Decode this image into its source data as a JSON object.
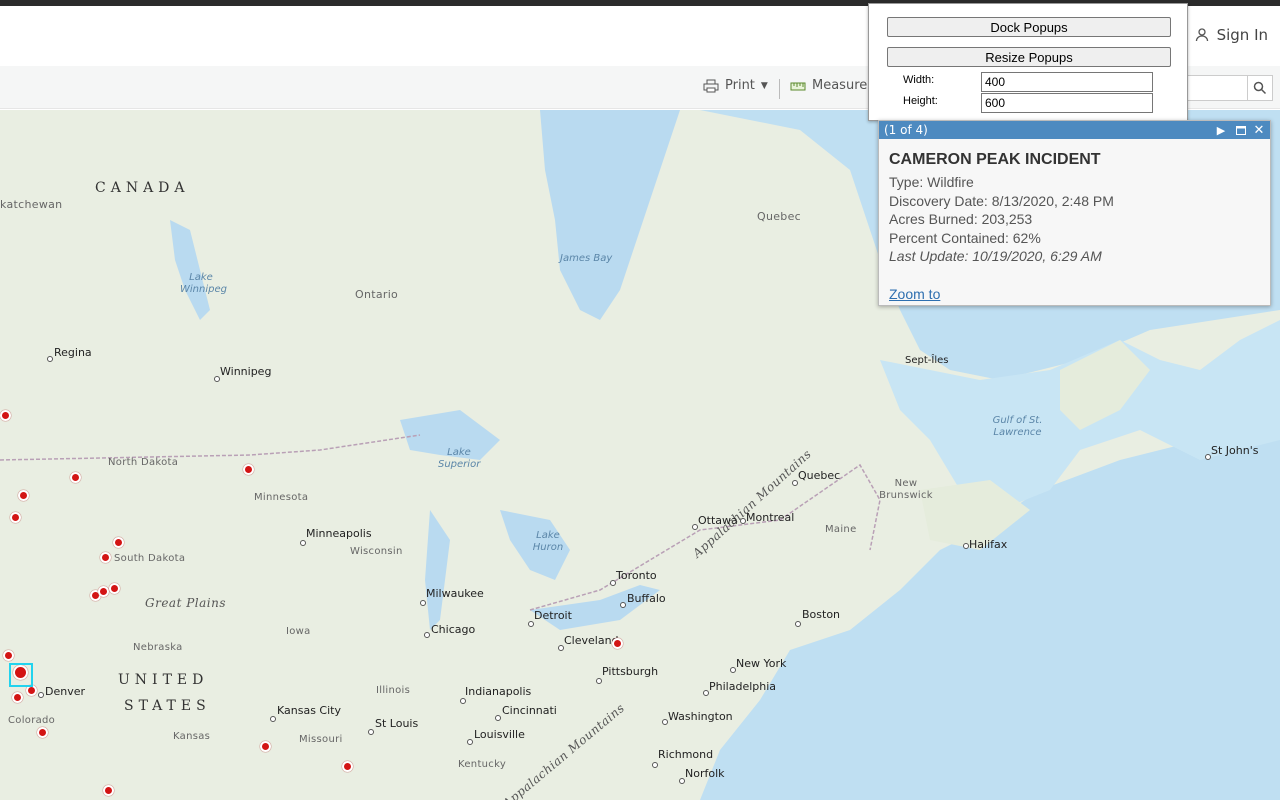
{
  "header": {
    "signin_label": "Sign In"
  },
  "toolbar": {
    "print_label": "Print",
    "measure_label": "Measure"
  },
  "resize_panel": {
    "dock_label": "Dock Popups",
    "resize_label": "Resize Popups",
    "width_label": "Width:",
    "height_label": "Height:",
    "width_value": "400",
    "height_value": "600"
  },
  "popup": {
    "counter": "(1 of 4)",
    "title": "CAMERON PEAK INCIDENT",
    "type": "Type: Wildfire",
    "discovery": "Discovery Date: 8/13/2020, 2:48 PM",
    "acres": "Acres Burned: 203,253",
    "contained": "Percent Contained: 62%",
    "updated": "Last Update: 10/19/2020, 6:29 AM",
    "zoom_label": "Zoom to"
  },
  "map": {
    "countries": [
      "CANADA",
      "UNITED",
      "STATES"
    ],
    "regions": [
      "Great Plains",
      "Appalachian Mountains",
      "Appalachian Mountains"
    ],
    "water": [
      "James Bay",
      "Lake Winnipeg",
      "Lake Superior",
      "Lake Huron",
      "Gulf of St. Lawrence"
    ],
    "provinces": [
      "katchewan",
      "Ontario",
      "Quebec",
      "New Brunswick",
      "Maine"
    ],
    "states": [
      "North Dakota",
      "Minnesota",
      "South Dakota",
      "Wisconsin",
      "Nebraska",
      "Iowa",
      "Illinois",
      "Missouri",
      "Kansas",
      "Colorado",
      "Kentucky"
    ],
    "cities": [
      "Regina",
      "Winnipeg",
      "Sept-Îles",
      "St John's",
      "Quebec",
      "Montreal",
      "Ottawa",
      "Halifax",
      "Toronto",
      "Buffalo",
      "Boston",
      "Minneapolis",
      "Milwaukee",
      "Detroit",
      "Chicago",
      "Cleveland",
      "Pittsburgh",
      "New York",
      "Philadelphia",
      "Washington",
      "Richmond",
      "Norfolk",
      "Indianapolis",
      "Cincinnati",
      "Louisville",
      "Kansas City",
      "St Louis",
      "Denver"
    ]
  },
  "colors": {
    "popup_bar": "#4d8ac0",
    "fire": "#d31414",
    "link": "#2e6fb0"
  }
}
